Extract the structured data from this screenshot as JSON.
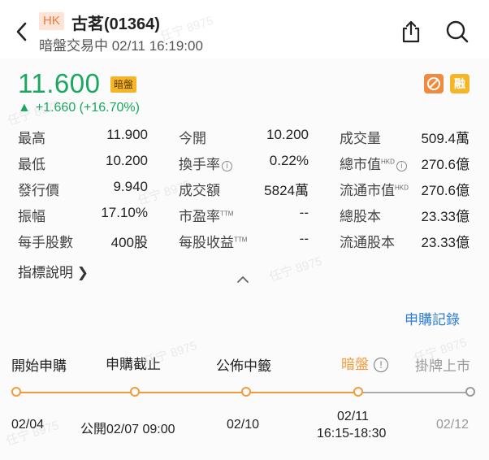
{
  "header": {
    "market": "HK",
    "title": "古茗(01364)",
    "status": "暗盤交易中 02/11 16:19:00"
  },
  "quote": {
    "price": "11.600",
    "dark_badge": "暗盤",
    "change": "+1.660 (+16.70%)",
    "margin_icon": "融",
    "up_color": "#1aa760"
  },
  "stats": [
    {
      "label": "最高",
      "value": "11.900"
    },
    {
      "label": "今開",
      "value": "10.200"
    },
    {
      "label": "成交量",
      "value": "509.4萬"
    },
    {
      "label": "最低",
      "value": "10.200"
    },
    {
      "label": "換手率",
      "value": "0.22%"
    },
    {
      "label": "總市值",
      "sup": "HKD",
      "value": "270.6億"
    },
    {
      "label": "發行價",
      "value": "9.940"
    },
    {
      "label": "成交額",
      "value": "5824萬"
    },
    {
      "label": "流通市值",
      "sup": "HKD",
      "value": "270.6億"
    },
    {
      "label": "振幅",
      "value": "17.10%"
    },
    {
      "label": "市盈率",
      "sup": "TTM",
      "value": "--"
    },
    {
      "label": "總股本",
      "value": "23.33億"
    },
    {
      "label": "每手股數",
      "value": "400股"
    },
    {
      "label": "每股收益",
      "sup": "TTM",
      "value": "--"
    },
    {
      "label": "流通股本",
      "value": "23.33億"
    }
  ],
  "indicator_link": "指標說明 ❯",
  "subscription_record": "申購記錄",
  "timeline": {
    "stages": [
      "開始申購",
      "申購截止",
      "公佈中籤",
      "暗盤",
      "掛牌上市"
    ],
    "dates": [
      "02/04",
      "公開02/07 09:00",
      "02/10",
      "02/11",
      "16:15-18:30",
      "02/12"
    ],
    "active_color": "#f39a3c",
    "inactive_color": "#aaaaaa"
  },
  "watermark": "任宁 8975"
}
